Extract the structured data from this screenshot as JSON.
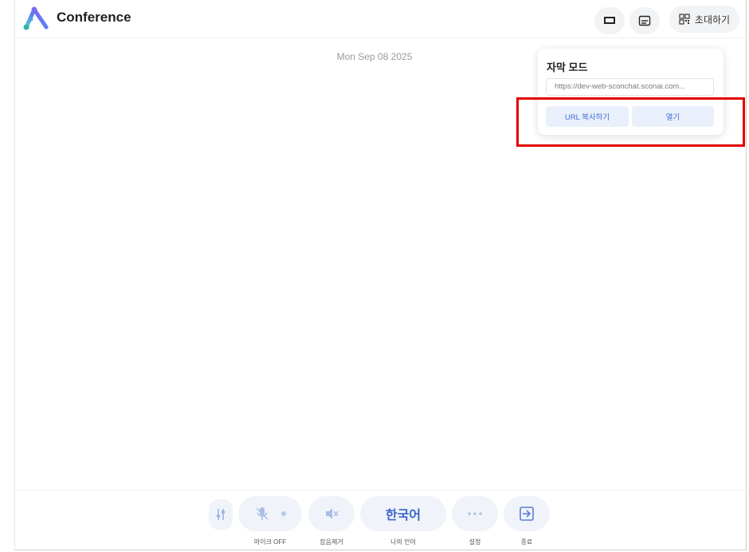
{
  "header": {
    "app_title": "Conference",
    "invite_label": "초대하기"
  },
  "main": {
    "date": "Mon Sep 08 2025"
  },
  "subtitle_popover": {
    "title": "자막 모드",
    "url_value": "https://dev-web-sconchat.sconai.com...",
    "copy_url_label": "URL 복사하기",
    "open_label": "열기"
  },
  "controls": {
    "mic_label": "마이크 OFF",
    "noise_label": "잡음제거",
    "language_value": "한국어",
    "language_label": "나의 언어",
    "settings_label": "설정",
    "end_label": "종료"
  },
  "colors": {
    "accent": "#3b66c9",
    "highlight": "#e30000",
    "button_bg": "#eaf0fb"
  }
}
